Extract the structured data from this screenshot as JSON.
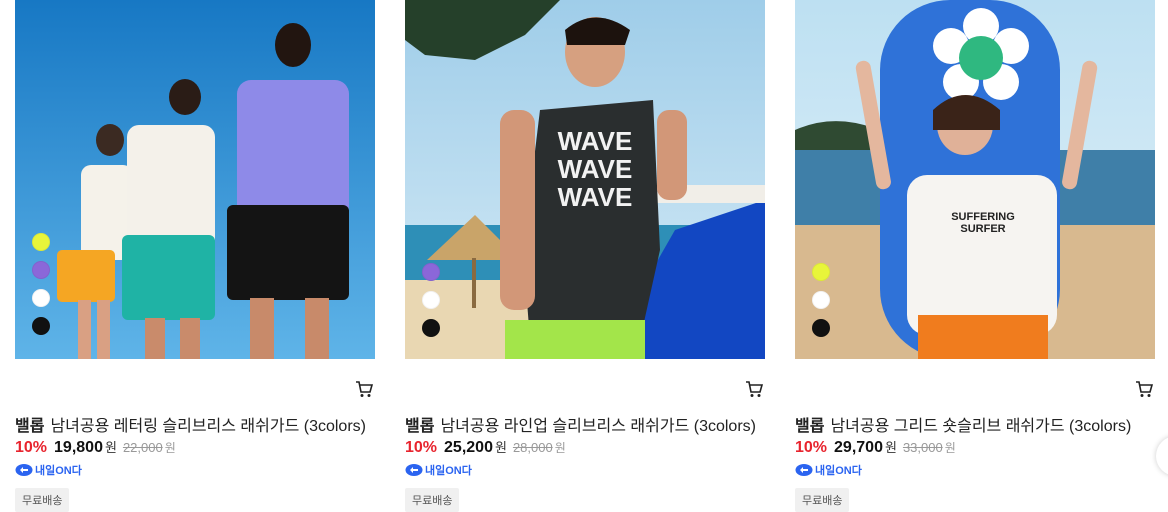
{
  "products": [
    {
      "brand": "밸롭",
      "name": "남녀공용 레터링 슬리브리스 래쉬가드 (3colors)",
      "discount": "10%",
      "price": "19,800",
      "won": "원",
      "original_price": "22,000",
      "original_won": "원",
      "delivery_badge": "내일ON다",
      "shipping_tag": "무료배송",
      "cart_icon": "cart-icon",
      "swatches": [
        "#e8f53a",
        "#8b67d9",
        "#ffffff",
        "#111111"
      ]
    },
    {
      "brand": "밸롭",
      "name": "남녀공용 라인업 슬리브리스 래쉬가드 (3colors)",
      "discount": "10%",
      "price": "25,200",
      "won": "원",
      "original_price": "28,000",
      "original_won": "원",
      "delivery_badge": "내일ON다",
      "shipping_tag": "무료배송",
      "cart_icon": "cart-icon",
      "swatches": [
        "#8b67d9",
        "#ffffff",
        "#111111"
      ]
    },
    {
      "brand": "밸롭",
      "name": "남녀공용 그리드 숏슬리브 래쉬가드 (3colors)",
      "discount": "10%",
      "price": "29,700",
      "won": "원",
      "original_price": "33,000",
      "original_won": "원",
      "delivery_badge": "내일ON다",
      "shipping_tag": "무료배송",
      "cart_icon": "cart-icon",
      "swatches": [
        "#e8f53a",
        "#ffffff",
        "#111111"
      ]
    }
  ],
  "colors": {
    "discount": "#e8242e",
    "badge": "#2b64f0"
  }
}
